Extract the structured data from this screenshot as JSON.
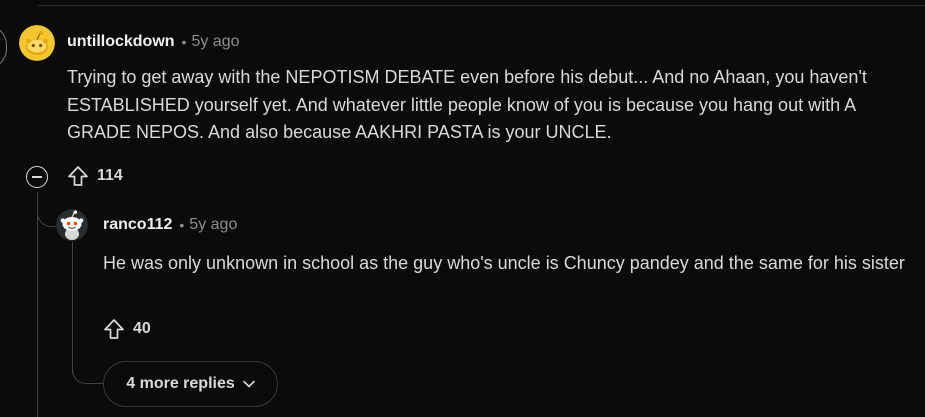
{
  "comment": {
    "author": "untillockdown",
    "separator": "•",
    "age": "5y ago",
    "body": "Trying to get away with the NEPOTISM DEBATE even before his debut... And no Ahaan, you haven't ESTABLISHED yourself yet. And whatever little people know of you is because you hang out with A GRADE NEPOS. And also because AAKHRI PASTA is your UNCLE.",
    "upvotes": "114",
    "avatar_icon": "snoo-avatar-yellow-icon",
    "collapse_icon": "collapse-minus-icon",
    "upvote_icon": "upvote-arrow-icon"
  },
  "reply": {
    "author": "ranco112",
    "separator": "•",
    "age": "5y ago",
    "body": "He was only unknown in school as the guy who's uncle is Chuncy pandey and the same for his sister",
    "upvotes": "40",
    "avatar_icon": "snoo-avatar-white-icon",
    "upvote_icon": "upvote-arrow-icon"
  },
  "more_replies": {
    "label": "4 more replies",
    "icon": "chevron-down-icon"
  },
  "colors": {
    "background": "#0b0b0c",
    "text": "#d7dadc",
    "meta": "#8b8e91",
    "thread_line": "#3f4244",
    "avatar_yellow": "#f7c52c"
  }
}
